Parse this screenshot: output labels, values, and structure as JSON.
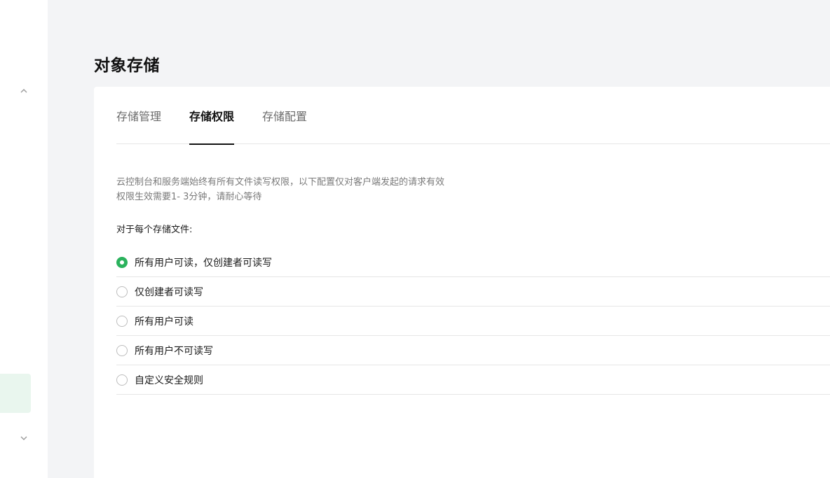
{
  "colors": {
    "accent": "#2bb25d",
    "sidebar_active_bg": "#e9f6ee",
    "page_bg": "#f3f4f6"
  },
  "sidebar": {
    "collapse_icon": "chevron-up-icon",
    "expand_icon": "chevron-down-icon"
  },
  "header": {
    "title": "对象存储"
  },
  "tabs": [
    {
      "label": "存储管理",
      "active": false
    },
    {
      "label": "存储权限",
      "active": true
    },
    {
      "label": "存储配置",
      "active": false
    }
  ],
  "description": {
    "line1": "云控制台和服务端始终有所有文件读写权限，以下配置仅对客户端发起的请求有效",
    "line2": "权限生效需要1- 3分钟，请耐心等待"
  },
  "permission": {
    "prompt": "对于每个存储文件:",
    "selected_index": 0,
    "options": [
      {
        "label": "所有用户可读，仅创建者可读写",
        "checked": true
      },
      {
        "label": "仅创建者可读写",
        "checked": false
      },
      {
        "label": "所有用户可读",
        "checked": false
      },
      {
        "label": "所有用户不可读写",
        "checked": false
      },
      {
        "label": "自定义安全规则",
        "checked": false
      }
    ]
  }
}
